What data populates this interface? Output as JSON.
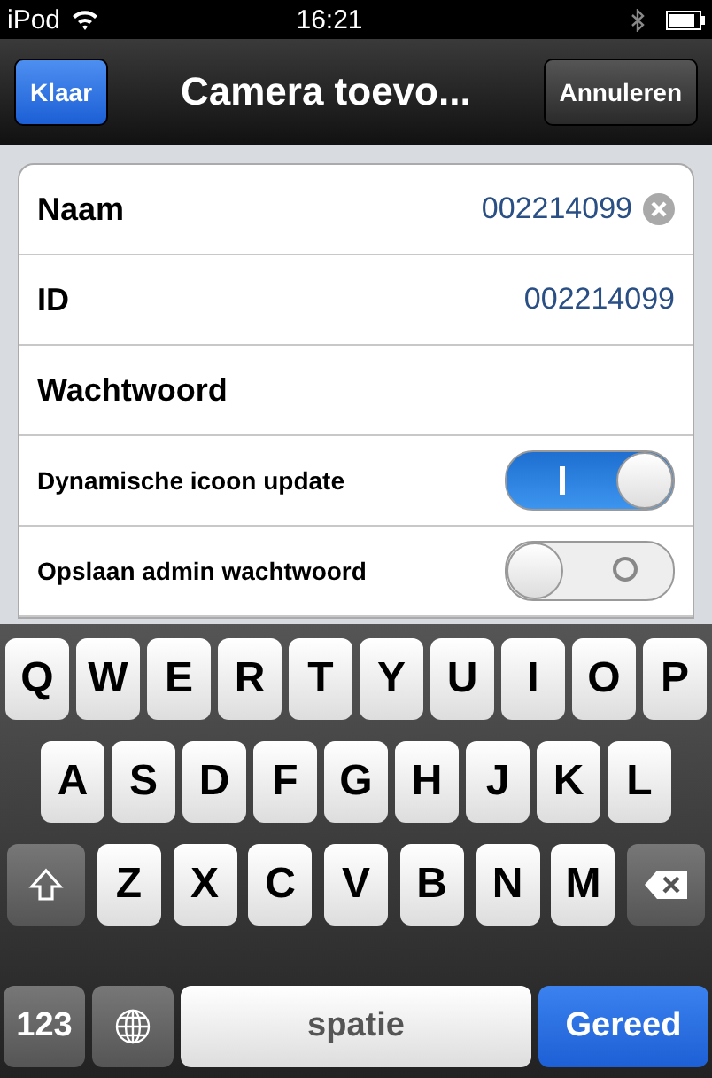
{
  "status_bar": {
    "carrier": "iPod",
    "time": "16:21"
  },
  "nav_bar": {
    "left_button": "Klaar",
    "title": "Camera toevo...",
    "right_button": "Annuleren"
  },
  "rows": [
    {
      "kind": "text",
      "label": "Naam",
      "value": "002214099",
      "clearable": true
    },
    {
      "kind": "text",
      "label": "ID",
      "value": "002214099",
      "clearable": false
    },
    {
      "kind": "text",
      "label": "Wachtwoord",
      "clearable": false
    },
    {
      "kind": "toggle",
      "label": "Dynamische icoon update",
      "on": true
    },
    {
      "kind": "toggle",
      "label": "Opslaan admin wachtwoord",
      "on": false
    }
  ],
  "keyboard": {
    "rows": [
      [
        "Q",
        "W",
        "E",
        "R",
        "T",
        "Y",
        "U",
        "I",
        "O",
        "P"
      ],
      [
        "A",
        "S",
        "D",
        "F",
        "G",
        "H",
        "J",
        "K",
        "L"
      ],
      [
        "Z",
        "X",
        "C",
        "V",
        "B",
        "N",
        "M"
      ]
    ],
    "numbers_key": "123",
    "space_key": "spatie",
    "return_key": "Gereed"
  }
}
